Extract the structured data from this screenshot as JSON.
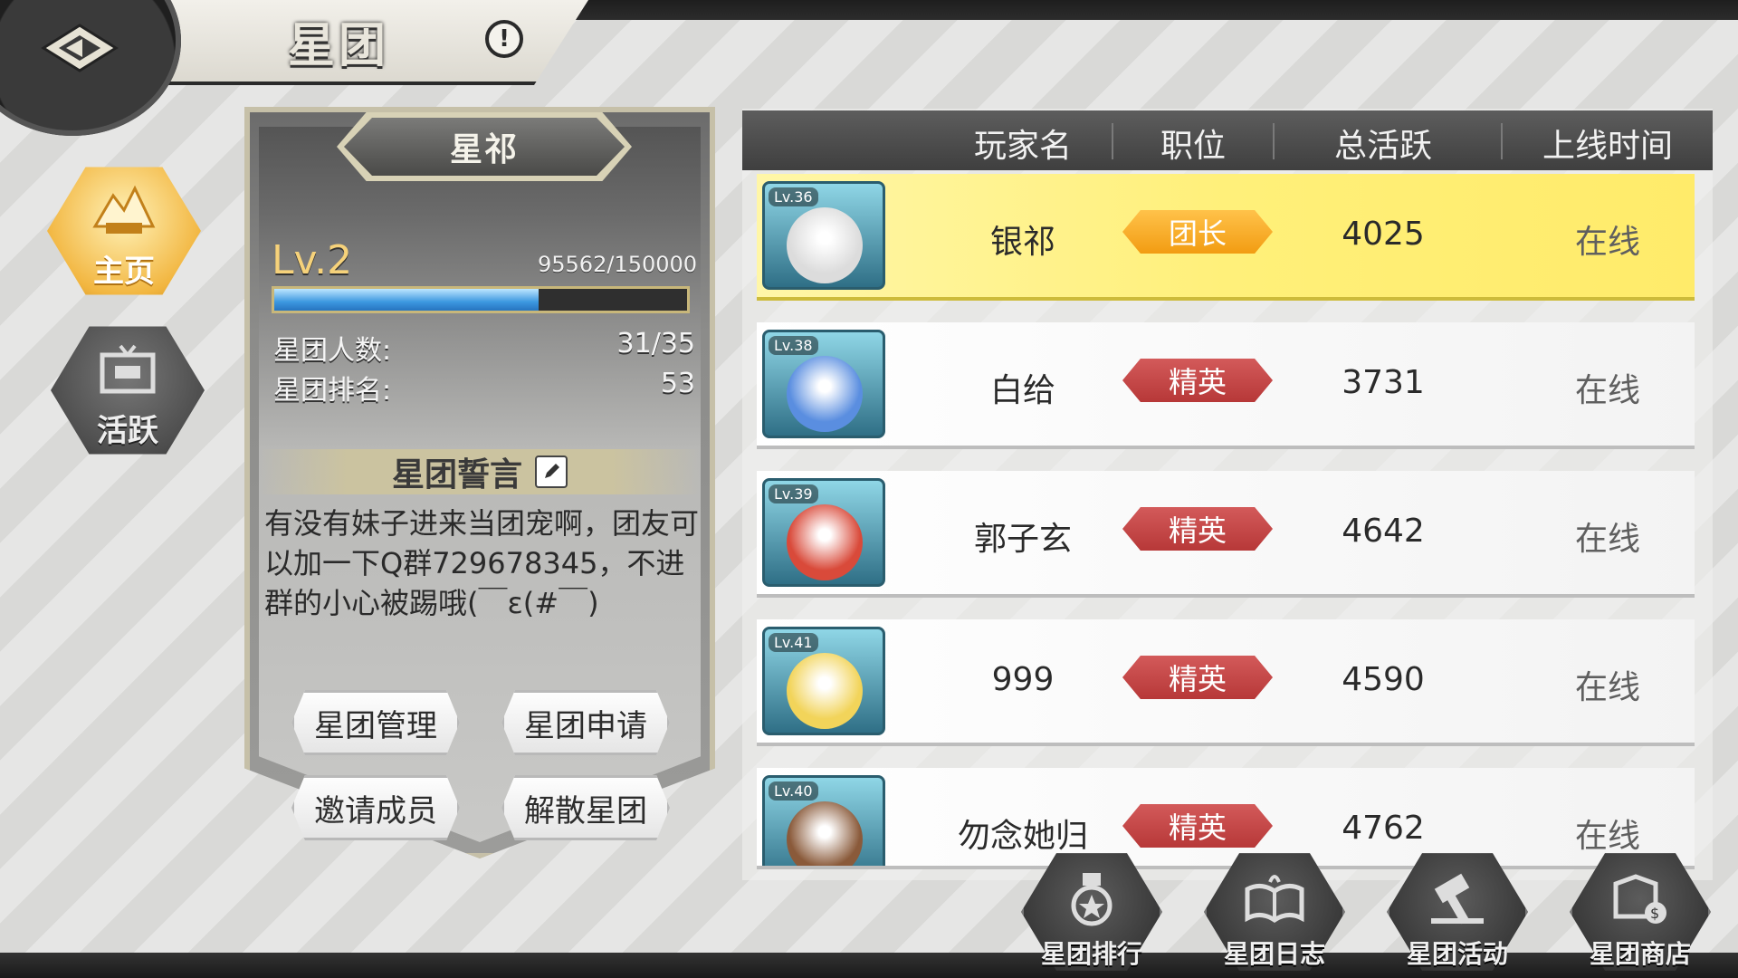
{
  "header": {
    "title": "星团",
    "info_label": "!"
  },
  "nav": {
    "home_label": "主页",
    "activity_label": "活跃"
  },
  "guild": {
    "name": "星祁",
    "level": "Lv.2",
    "exp_text": "95562/150000",
    "exp_progress": 0.64,
    "members_label": "星团人数:",
    "members_value": "31/35",
    "rank_label": "星团排名:",
    "rank_value": "53",
    "motto_title": "星团誓言",
    "motto_text": "有没有妹子进来当团宠啊，团友可以加一下Q群729678345，不进群的小心被踢哦(￣ε(#￣)",
    "buttons": [
      "星团管理",
      "星团申请",
      "邀请成员",
      "解散星团"
    ]
  },
  "member_list": {
    "columns": [
      "玩家名",
      "职位",
      "总活跃",
      "上线时间"
    ],
    "rows": [
      {
        "level": "Lv.36",
        "name": "银祁",
        "position": "团长",
        "activity": "4025",
        "online": "在线",
        "avatar_color": "#dcdcdc"
      },
      {
        "level": "Lv.38",
        "name": "白给",
        "position": "精英",
        "activity": "3731",
        "online": "在线",
        "avatar_color": "#5a8ee0"
      },
      {
        "level": "Lv.39",
        "name": "郭子玄",
        "position": "精英",
        "activity": "4642",
        "online": "在线",
        "avatar_color": "#d94a3a"
      },
      {
        "level": "Lv.41",
        "name": "999",
        "position": "精英",
        "activity": "4590",
        "online": "在线",
        "avatar_color": "#f2d45a"
      },
      {
        "level": "Lv.40",
        "name": "勿念她归",
        "position": "精英",
        "activity": "4762",
        "online": "在线",
        "avatar_color": "#8a5a3a"
      }
    ]
  },
  "bottom_nav": {
    "ranking": "星团排行",
    "log": "星团日志",
    "events": "星团活动",
    "shop": "星团商店"
  },
  "colors": {
    "leader_row": "#fff07a",
    "leader_badge": "#f29c12",
    "elite_badge": "#b73838",
    "exp_fill": "#3c98e0"
  },
  "icons": {
    "back": "back-arrow-icon",
    "info": "info-icon",
    "home": "home-icon",
    "activity": "activity-icon",
    "edit": "edit-icon",
    "ranking": "medal-icon",
    "log": "book-icon",
    "events": "hammer-icon",
    "shop": "shop-icon"
  }
}
